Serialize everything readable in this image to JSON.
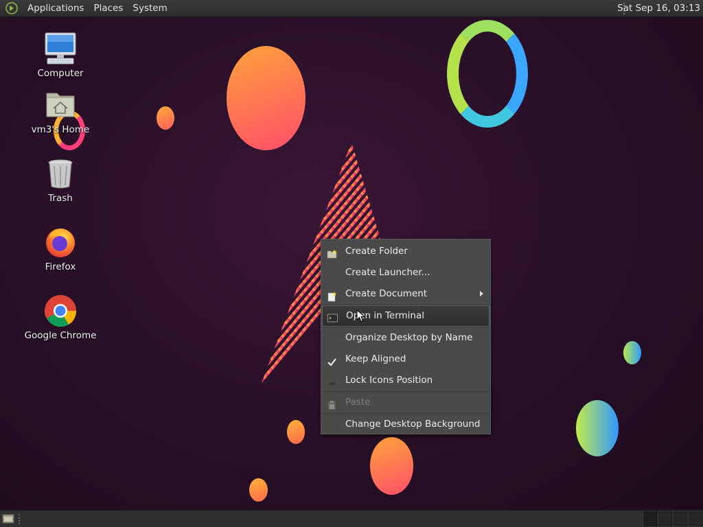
{
  "top_panel": {
    "menus": [
      "Applications",
      "Places",
      "System"
    ],
    "clock": "Sat Sep 16, 03:13"
  },
  "desktop_icons": [
    {
      "label": "Computer",
      "icon": "computer-icon"
    },
    {
      "label": "vm3's Home",
      "icon": "home-folder-icon"
    },
    {
      "label": "Trash",
      "icon": "trash-icon"
    },
    {
      "label": "Firefox",
      "icon": "firefox-icon"
    },
    {
      "label": "Google Chrome",
      "icon": "chrome-icon"
    }
  ],
  "context_menu": {
    "items": [
      {
        "label": "Create Folder",
        "icon": "folder-new-icon"
      },
      {
        "label": "Create Launcher...",
        "icon": ""
      },
      {
        "label": "Create Document",
        "icon": "document-new-icon",
        "submenu": true
      },
      {
        "label": "Open in Terminal",
        "icon": "terminal-icon",
        "hovered": true
      },
      {
        "label": "Organize Desktop by Name",
        "icon": ""
      },
      {
        "label": "Keep Aligned",
        "icon": "checkmark-icon",
        "checked": true
      },
      {
        "label": "Lock Icons Position",
        "icon": "lock-toggle-icon"
      },
      {
        "label": "Paste",
        "icon": "paste-icon",
        "disabled": true
      },
      {
        "label": "Change Desktop Background",
        "icon": ""
      }
    ]
  },
  "colors": {
    "desktop_bg": "#2a1028",
    "panel_bg": "#2d2d2d",
    "menu_bg": "#4a4a4a"
  }
}
